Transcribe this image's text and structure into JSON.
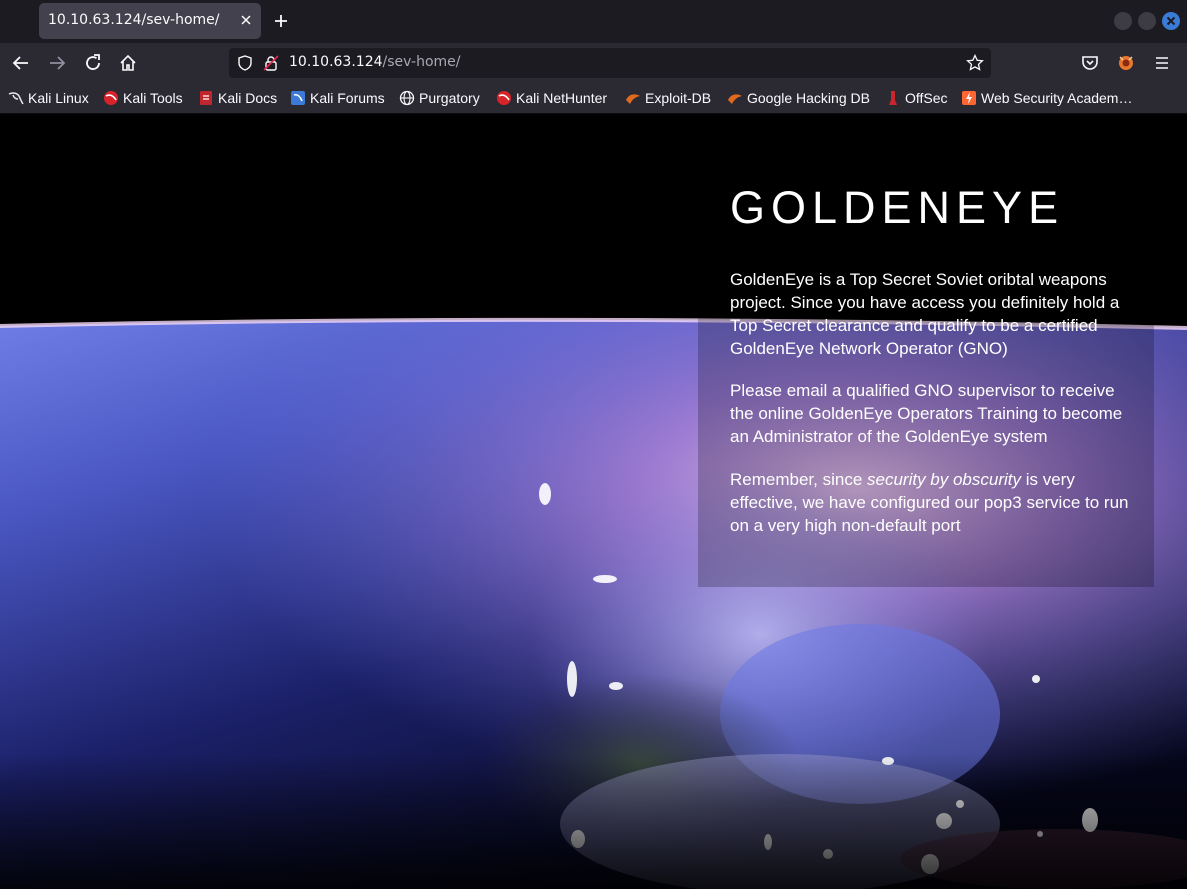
{
  "browser": {
    "tab": {
      "title": "10.10.63.124/sev-home/"
    },
    "url": {
      "host": "10.10.63.124",
      "path": "/sev-home/"
    },
    "bookmarks": [
      {
        "label": "Kali Linux",
        "icon": "kali-dragon-icon"
      },
      {
        "label": "Kali Tools",
        "icon": "kali-icon"
      },
      {
        "label": "Kali Docs",
        "icon": "kali-docs-icon"
      },
      {
        "label": "Kali Forums",
        "icon": "kali-forums-icon"
      },
      {
        "label": "Purgatory",
        "icon": "globe-icon"
      },
      {
        "label": "Kali NetHunter",
        "icon": "kali-icon"
      },
      {
        "label": "Exploit-DB",
        "icon": "exploit-db-icon"
      },
      {
        "label": "Google Hacking DB",
        "icon": "exploit-db-icon"
      },
      {
        "label": "OffSec",
        "icon": "offsec-icon"
      },
      {
        "label": "Web Security Academ…",
        "icon": "portswigger-icon"
      }
    ]
  },
  "page": {
    "title": "GOLDENEYE",
    "paragraphs": {
      "p1": "GoldenEye is a Top Secret Soviet oribtal weapons project. Since you have access you definitely hold a Top Secret clearance and qualify to be a certified GoldenEye Network Operator (GNO)",
      "p2": "Please email a qualified GNO supervisor to receive the online GoldenEye Operators Training to become an Administrator of the GoldenEye system",
      "p3_before": "Remember, since ",
      "p3_em": "security by obscurity",
      "p3_after": " is very effective, we have configured our pop3 service to run on a very high non-default port"
    }
  },
  "colors": {
    "chrome_dark": "#1c1b22",
    "toolbar": "#2b2a33",
    "tab_active": "#42414d",
    "accent_blue": "#3a7bd5"
  }
}
